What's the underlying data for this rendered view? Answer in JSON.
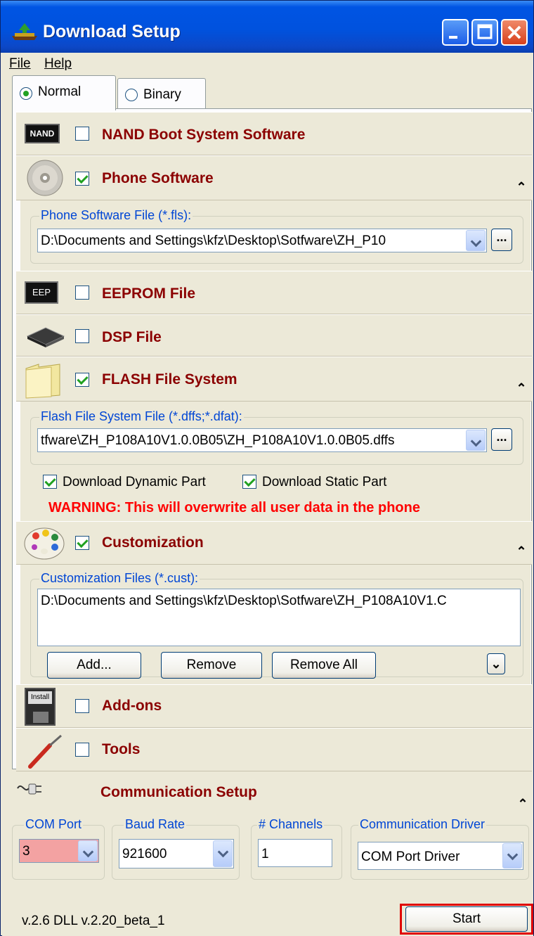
{
  "window": {
    "title": "Download Setup"
  },
  "menu": {
    "file": "File",
    "help": "Help"
  },
  "tabs": [
    {
      "label": "Normal",
      "selected": true
    },
    {
      "label": "Binary",
      "selected": false
    }
  ],
  "sections": {
    "nand": {
      "title": "NAND Boot System Software",
      "checked": false,
      "icon_label": "NAND"
    },
    "phone": {
      "title": "Phone Software",
      "checked": true,
      "file_group": "Phone Software File (*.fls):",
      "file_value": "D:\\Documents and Settings\\kfz\\Desktop\\Sotfware\\ZH_P10",
      "browse": "..."
    },
    "eeprom": {
      "title": "EEPROM File",
      "checked": false,
      "icon_label": "EEP"
    },
    "dsp": {
      "title": "DSP File",
      "checked": false
    },
    "flash": {
      "title": "FLASH File System",
      "checked": true,
      "file_group": "Flash File System File (*.dffs;*.dfat):",
      "file_value": "tfware\\ZH_P108A10V1.0.0B05\\ZH_P108A10V1.0.0B05.dffs",
      "browse": "...",
      "dynamic_label": "Download Dynamic Part",
      "static_label": "Download Static Part",
      "warning": "WARNING: This will overwrite all user data in the phone"
    },
    "custom": {
      "title": "Customization",
      "checked": true,
      "file_group": "Customization Files (*.cust):",
      "items": [
        "D:\\Documents and Settings\\kfz\\Desktop\\Sotfware\\ZH_P108A10V1.C"
      ],
      "add": "Add...",
      "remove": "Remove",
      "remove_all": "Remove All"
    },
    "addons": {
      "title": "Add-ons",
      "checked": false,
      "icon_label": "Install"
    },
    "tools": {
      "title": "Tools",
      "checked": false
    }
  },
  "comm": {
    "title": "Communication Setup",
    "com_port_label": "COM Port",
    "com_port_value": "3",
    "baud_label": "Baud Rate",
    "baud_value": "921600",
    "channels_label": "# Channels",
    "channels_value": "1",
    "driver_label": "Communication Driver",
    "driver_value": "COM Port Driver"
  },
  "status": {
    "version": "v.2.6  DLL v.2.20_beta_1",
    "start": "Start"
  },
  "colors": {
    "section_title": "#8b0000",
    "warning": "#ff0000",
    "group_title": "#0046d5",
    "highlight": "#e00000"
  }
}
